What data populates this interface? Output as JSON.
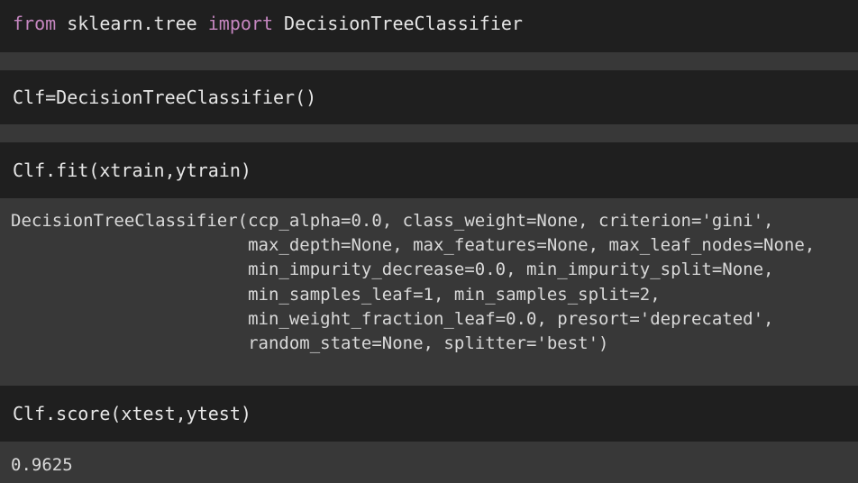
{
  "cells": [
    {
      "code_parts": [
        "from",
        " sklearn.tree ",
        "import",
        " DecisionTreeClassifier"
      ]
    },
    {
      "code": "Clf=DecisionTreeClassifier()"
    },
    {
      "code": "Clf.fit(xtrain,ytrain)",
      "output_lines": [
        "DecisionTreeClassifier(ccp_alpha=0.0, class_weight=None, criterion='gini',",
        "                       max_depth=None, max_features=None, max_leaf_nodes=None,",
        "                       min_impurity_decrease=0.0, min_impurity_split=None,",
        "                       min_samples_leaf=1, min_samples_split=2,",
        "                       min_weight_fraction_leaf=0.0, presort='deprecated',",
        "                       random_state=None, splitter='best')"
      ]
    },
    {
      "code": "Clf.score(xtest,ytest)",
      "output": "0.9625"
    }
  ],
  "colors": {
    "cell_background": "#1f1f1f",
    "output_background": "#383838",
    "keyword": "#c586c0",
    "text": "#e6e6e6"
  }
}
